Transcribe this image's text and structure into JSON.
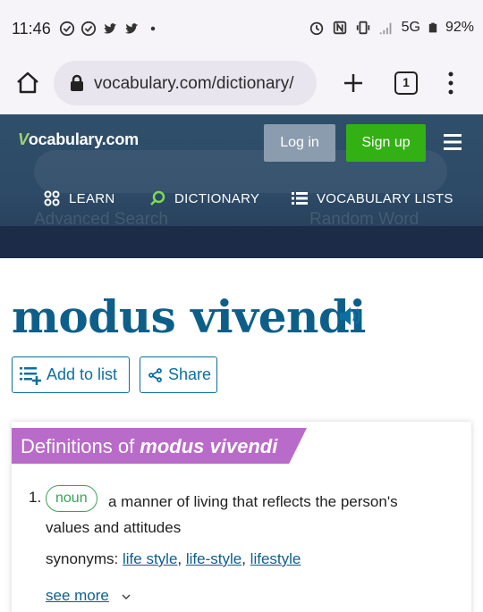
{
  "status_bar": {
    "time": "11:46",
    "network": "5G",
    "battery": "92%"
  },
  "browser": {
    "url": "vocabulary.com/dictionary/",
    "tab_count": "1"
  },
  "site": {
    "logo_text": "ocabulary.com",
    "logo_letter": "V",
    "login_label": "Log in",
    "signup_label": "Sign up",
    "nav": [
      {
        "label": "LEARN",
        "icon": "grid-icon"
      },
      {
        "label": "DICTIONARY",
        "icon": "search-icon"
      },
      {
        "label": "VOCABULARY LISTS",
        "icon": "list-icon"
      }
    ],
    "ghost_advanced": "Advanced Search",
    "ghost_random": "Random Word"
  },
  "word": {
    "title": "modus vivendi",
    "add_to_list_label": "Add to list",
    "share_label": "Share"
  },
  "definitions": {
    "banner_prefix": "Definitions of ",
    "banner_word": "modus vivendi",
    "items": [
      {
        "number": "1.",
        "pos": "noun",
        "text": "a manner of living that reflects the person's values and attitudes",
        "synonyms_label": "synonyms:",
        "synonyms": [
          "life style",
          "life-style",
          "lifestyle"
        ]
      }
    ],
    "see_more": "see more"
  },
  "colors": {
    "header_bg": "#2d4a66",
    "signup_green": "#33b013",
    "title_blue": "#0d5f8a",
    "banner_purple": "#b96bc9",
    "noun_green": "#3aa257"
  }
}
